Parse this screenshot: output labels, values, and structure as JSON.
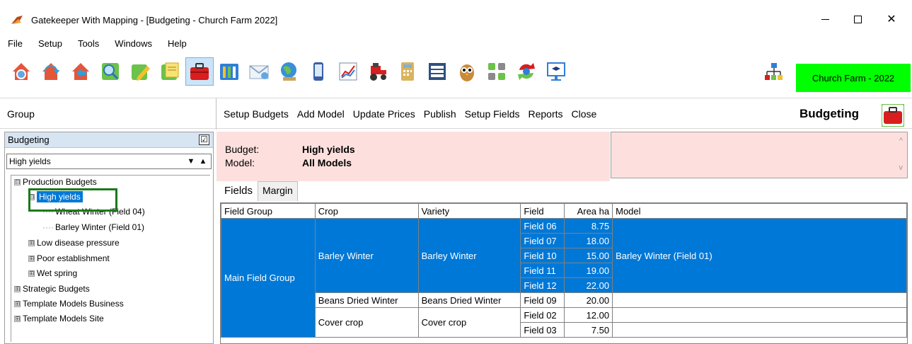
{
  "window": {
    "title": "Gatekeeper With Mapping - [Budgeting - Church Farm 2022]",
    "minimize_icon": "minimize-icon",
    "maximize_icon": "maximize-icon",
    "close_glyph": "✕"
  },
  "menu": [
    "File",
    "Setup",
    "Tools",
    "Windows",
    "Help"
  ],
  "toolbar": {
    "icons": [
      "home-icon",
      "sync-icon",
      "back-home-icon",
      "search-icon",
      "edit-icon",
      "notes-icon",
      "budgeting-icon",
      "columns-icon",
      "mail-icon",
      "globe-icon",
      "phone-icon",
      "chart-icon",
      "tractor-icon",
      "calculator-icon",
      "owl-icon",
      "grid-icon",
      "refresh-icon",
      "training-icon"
    ],
    "active_index": 6,
    "org_icon": "org-chart-icon",
    "farm_badge": "Church Farm - 2022",
    "farm_badge_color": "#00ff00"
  },
  "header": {
    "group_label": "Group",
    "actions": [
      "Setup Budgets",
      "Add Model",
      "Update Prices",
      "Publish",
      "Setup Fields",
      "Reports",
      "Close"
    ],
    "module_title": "Budgeting"
  },
  "left_panel": {
    "title": "Budgeting",
    "checkbox_glyph": "☑",
    "search_value": "High yields",
    "arrow_down": "▼",
    "arrow_up": "▲",
    "tree": [
      {
        "label": "Production Budgets",
        "expander": "⊟",
        "level": 0
      },
      {
        "label": "High yields",
        "expander": "⊟",
        "level": 1,
        "selected": true
      },
      {
        "label": "Wheat Winter (Field 04)",
        "level": 2
      },
      {
        "label": "Barley Winter (Field 01)",
        "level": 2
      },
      {
        "label": "Low disease pressure",
        "expander": "⊞",
        "level": 1
      },
      {
        "label": "Poor establishment",
        "expander": "⊞",
        "level": 1
      },
      {
        "label": "Wet spring",
        "expander": "⊞",
        "level": 1
      },
      {
        "label": "Strategic Budgets",
        "expander": "⊞",
        "level": 0
      },
      {
        "label": "Template Models Business",
        "expander": "⊞",
        "level": 0
      },
      {
        "label": "Template Models Site",
        "expander": "⊞",
        "level": 0
      }
    ]
  },
  "info": {
    "budget_label": "Budget:",
    "budget_value": "High yields",
    "model_label": "Model:",
    "model_value": "All Models",
    "scroll_up": "^",
    "scroll_down": "v"
  },
  "tabs": [
    "Fields",
    "Margin"
  ],
  "grid": {
    "columns": [
      "Field Group",
      "Crop",
      "Variety",
      "Field",
      "Area ha",
      "Model"
    ],
    "group_value": "Main Field Group",
    "rows": [
      {
        "crop": "Barley Winter",
        "variety": "Barley Winter",
        "model": "Barley Winter (Field 01)",
        "fields": [
          {
            "field": "Field 06",
            "area": "8.75"
          },
          {
            "field": "Field 07",
            "area": "18.00"
          },
          {
            "field": "Field 10",
            "area": "15.00"
          },
          {
            "field": "Field 11",
            "area": "19.00"
          },
          {
            "field": "Field 12",
            "area": "22.00"
          }
        ],
        "selected": true
      },
      {
        "crop": "Beans Dried Winter",
        "variety": "Beans Dried Winter",
        "model": "",
        "fields": [
          {
            "field": "Field 09",
            "area": "20.00"
          }
        ]
      },
      {
        "crop": "Cover crop",
        "variety": "Cover crop",
        "model": "",
        "fields": [
          {
            "field": "Field 02",
            "area": "12.00"
          },
          {
            "field": "Field 03",
            "area": "7.50"
          }
        ]
      }
    ]
  }
}
